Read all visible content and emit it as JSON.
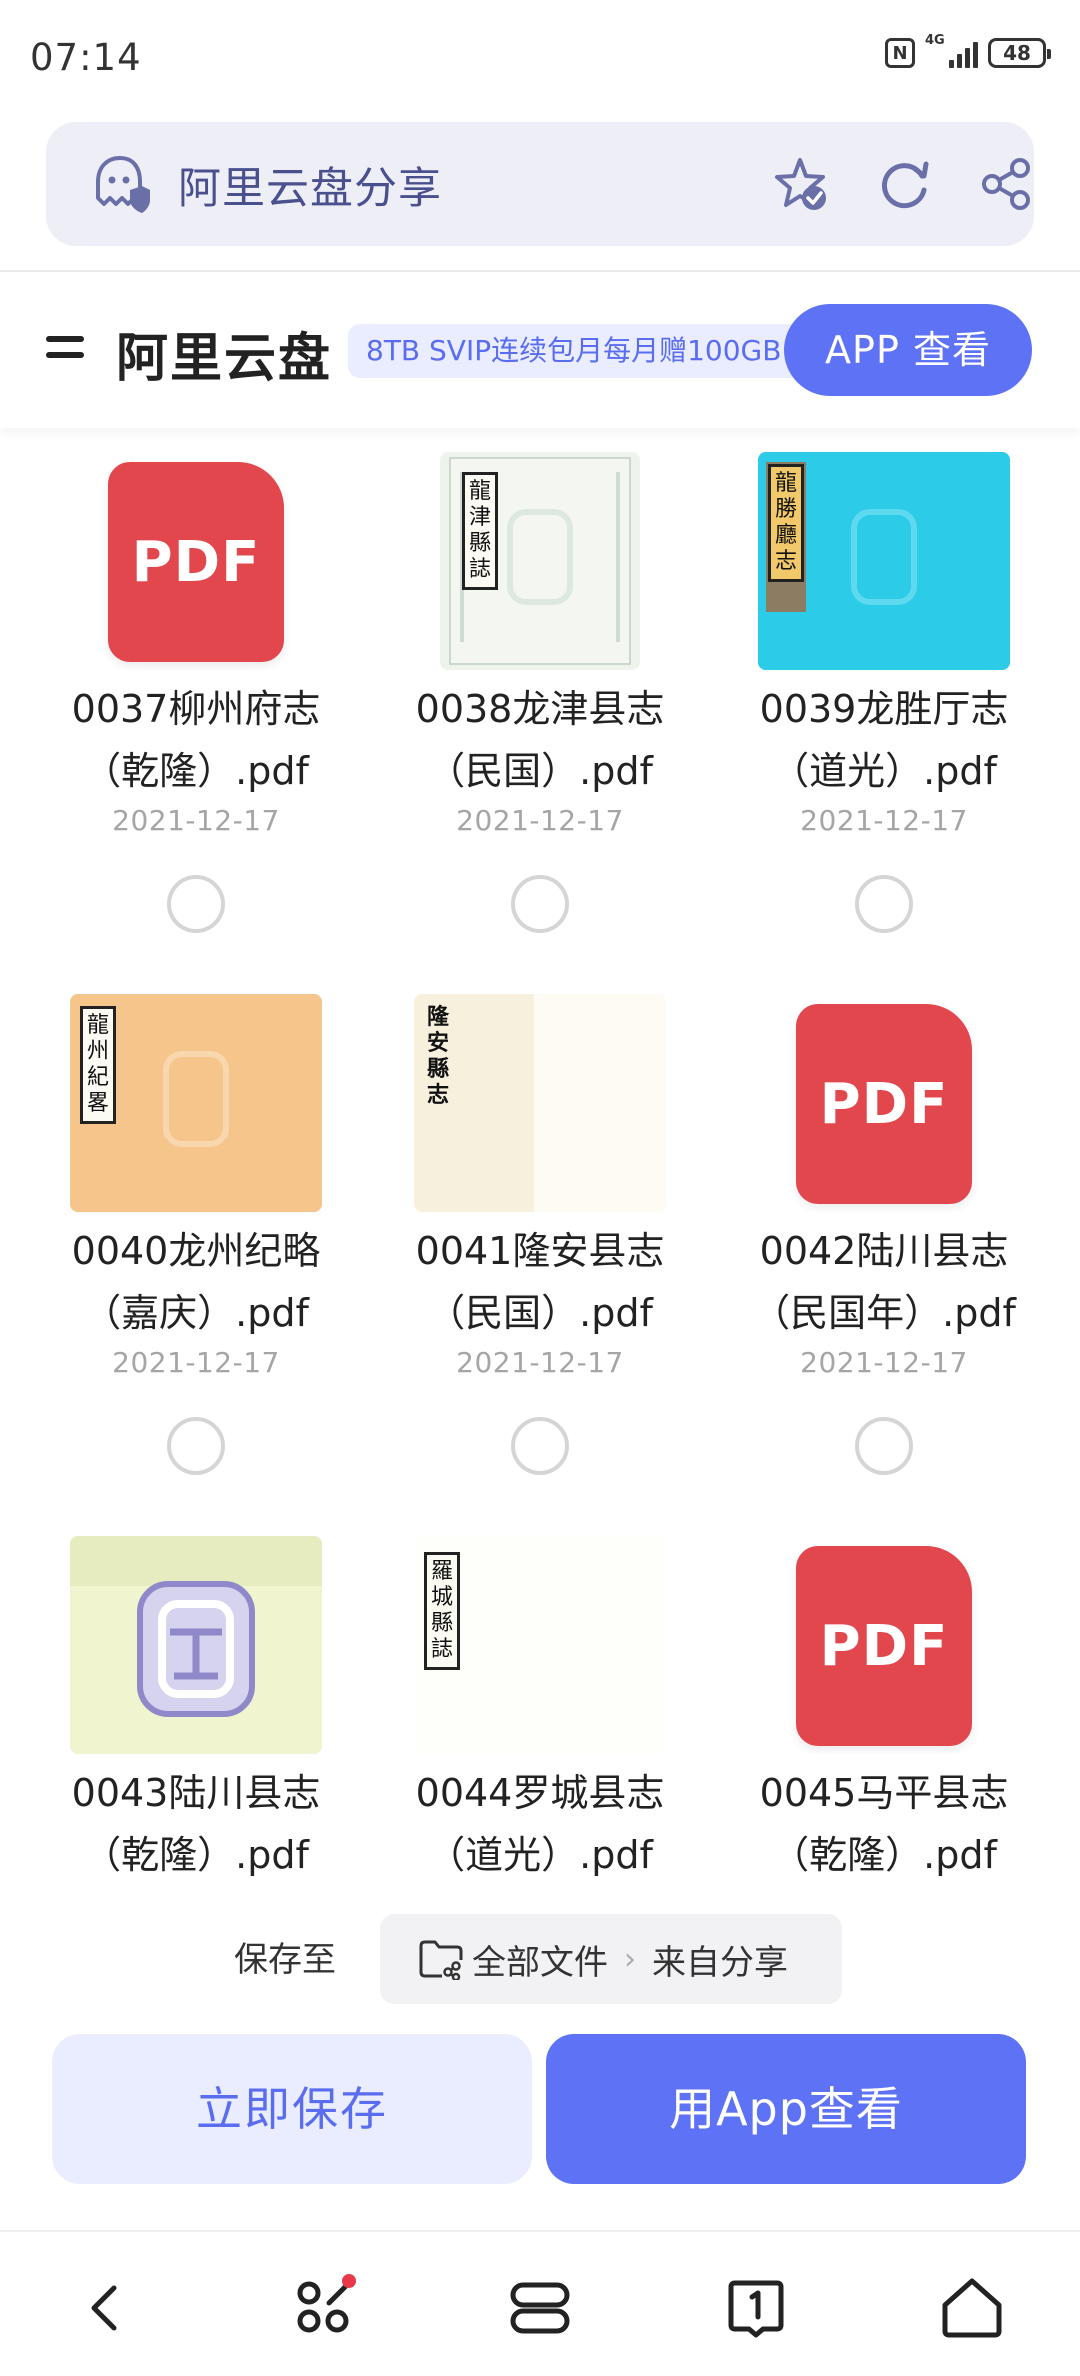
{
  "status_bar": {
    "time": "07:14",
    "network": "4G",
    "battery": "48"
  },
  "browser": {
    "page_title": "阿里云盘分享"
  },
  "header": {
    "brand": "阿里云盘",
    "promo": "8TB SVIP连续包月每月赠100GB",
    "app_view_button": "APP 查看"
  },
  "files": [
    {
      "name_line1": "0037柳州府志",
      "name_line2": "（乾隆）.pdf",
      "date": "2021-12-17",
      "thumb": "pdf"
    },
    {
      "name_line1": "0038龙津县志",
      "name_line2": "（民国）.pdf",
      "date": "2021-12-17",
      "thumb": "scan",
      "scan_label": "龍津縣誌"
    },
    {
      "name_line1": "0039龙胜厅志",
      "name_line2": "（道光）.pdf",
      "date": "2021-12-17",
      "thumb": "scan",
      "scan_label": "龍勝廳志"
    },
    {
      "name_line1": "0040龙州纪略",
      "name_line2": "（嘉庆）.pdf",
      "date": "2021-12-17",
      "thumb": "scan",
      "scan_label": "龍州紀畧"
    },
    {
      "name_line1": "0041隆安县志",
      "name_line2": "（民国）.pdf",
      "date": "2021-12-17",
      "thumb": "scan",
      "scan_label": "隆安縣志"
    },
    {
      "name_line1": "0042陆川县志",
      "name_line2": "（民国年）.pdf",
      "date": "2021-12-17",
      "thumb": "pdf"
    },
    {
      "name_line1": "0043陆川县志",
      "name_line2": "（乾隆）.pdf",
      "date": "",
      "thumb": "scan"
    },
    {
      "name_line1": "0044罗城县志",
      "name_line2": "（道光）.pdf",
      "date": "",
      "thumb": "scan",
      "scan_label": "羅城縣誌"
    },
    {
      "name_line1": "0045马平县志",
      "name_line2": "（乾隆）.pdf",
      "date": "",
      "thumb": "pdf"
    }
  ],
  "pdf_badge": "PDF",
  "save_to": {
    "label": "保存至",
    "path_root": "全部文件",
    "path_child": "来自分享"
  },
  "actions": {
    "save_now": "立即保存",
    "open_in_app": "用App查看"
  },
  "colors": {
    "accent": "#5d72f4",
    "accent_light": "#eaedff",
    "pdf_red": "#e2474d"
  }
}
